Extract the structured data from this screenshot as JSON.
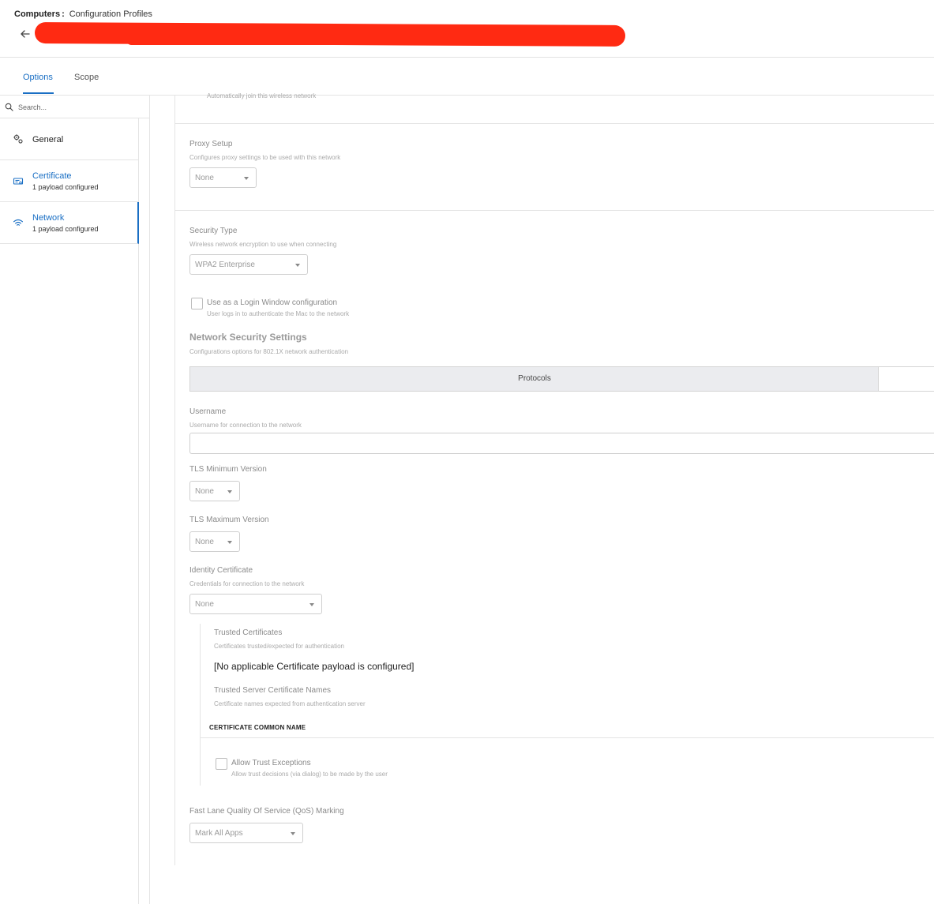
{
  "header": {
    "breadcrumb_root": "Computers",
    "breadcrumb_separator": ":",
    "breadcrumb_current": "Configuration Profiles"
  },
  "tabs": [
    {
      "label": "Options",
      "active": true
    },
    {
      "label": "Scope",
      "active": false
    }
  ],
  "search": {
    "placeholder": "Search..."
  },
  "sidebar": {
    "items": [
      {
        "label": "General",
        "icon": "gears-icon"
      },
      {
        "label": "Certificate",
        "sub": "1 payload configured",
        "icon": "certificate-icon"
      },
      {
        "label": "Network",
        "sub": "1 payload configured",
        "icon": "wifi-icon",
        "selected": true
      }
    ]
  },
  "form": {
    "auto_join_desc": "Automatically join this wireless network",
    "proxy": {
      "label": "Proxy Setup",
      "desc": "Configures proxy settings to be used with this network",
      "value": "None"
    },
    "security": {
      "label": "Security Type",
      "desc": "Wireless network encryption to use when connecting",
      "value": "WPA2 Enterprise"
    },
    "login_window": {
      "label": "Use as a Login Window configuration",
      "desc": "User logs in to authenticate the Mac to the network",
      "checked": false
    },
    "nss": {
      "title": "Network Security Settings",
      "desc": "Configurations options for 802.1X network authentication"
    },
    "protocols_tab": "Protocols",
    "username": {
      "label": "Username",
      "desc": "Username for connection to the network",
      "value": ""
    },
    "tls_min": {
      "label": "TLS Minimum Version",
      "value": "None"
    },
    "tls_max": {
      "label": "TLS Maximum Version",
      "value": "None"
    },
    "identity_cert": {
      "label": "Identity Certificate",
      "desc": "Credentials for connection to the network",
      "value": "None"
    },
    "trusted_certs": {
      "label": "Trusted Certificates",
      "desc": "Certificates trusted/expected for authentication",
      "message": "[No applicable Certificate payload is configured]"
    },
    "trusted_names": {
      "label": "Trusted Server Certificate Names",
      "desc": "Certificate names expected from authentication server",
      "column_header": "CERTIFICATE COMMON NAME"
    },
    "trust_exceptions": {
      "label": "Allow Trust Exceptions",
      "desc": "Allow trust decisions (via dialog) to be made by the user",
      "checked": false
    },
    "qos": {
      "label": "Fast Lane Quality Of Service (QoS) Marking",
      "value": "Mark All Apps"
    }
  },
  "colors": {
    "accent": "#1a6fc4",
    "redaction": "#ff2a12"
  }
}
